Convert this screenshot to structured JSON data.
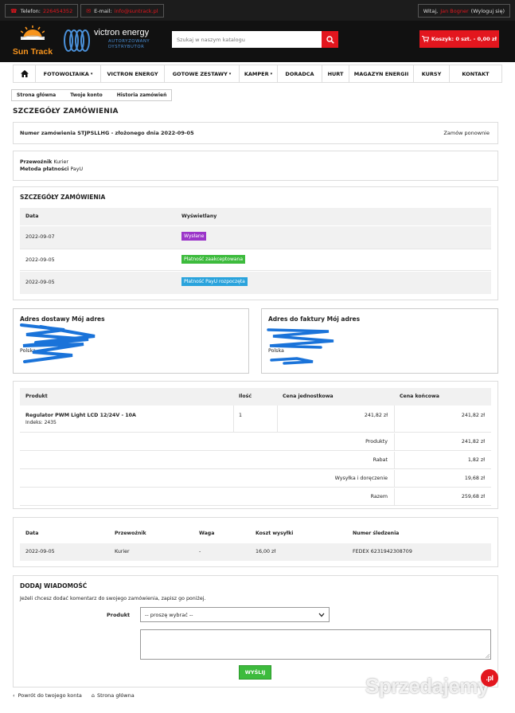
{
  "topbar": {
    "phone_label": "Telefon:",
    "phone_value": "226454352",
    "email_label": "E-mail:",
    "email_value": "info@suntrack.pl",
    "welcome": "Witaj,",
    "user_name": "Jan Bogner",
    "logout": "(Wyloguj się)"
  },
  "header": {
    "logo_name": "Sun Track",
    "victron_name": "victron energy",
    "victron_sub_1": "AUTORYZOWANY",
    "victron_sub_2": "DYSTRYBUTOR",
    "search_placeholder": "Szukaj w naszym katalogu",
    "cart_label": "Koszyk: 0 szt. - 0,00 zł"
  },
  "nav": {
    "items": [
      "FOTOWOLTAIKA",
      "VICTRON ENERGY",
      "GOTOWE ZESTAWY",
      "KAMPER",
      "DORADCA",
      "HURT",
      "MAGAZYN ENERGII",
      "KURSY",
      "KONTAKT"
    ]
  },
  "breadcrumb": [
    "Strona główna",
    "Twoje konto",
    "Historia zamówień"
  ],
  "page_title": "SZCZEGÓŁY ZAMÓWIENIA",
  "order": {
    "number_text": "Numer zamówienia STJPSLLHG - złożonego dnia 2022-09-05",
    "reorder": "Zamów ponownie"
  },
  "carrier": {
    "carrier_label": "Przewoźnik",
    "carrier_value": "Kurier",
    "payment_label": "Metoda płatności",
    "payment_value": "PayU"
  },
  "status": {
    "title": "SZCZEGÓŁY ZAMÓWIENIA",
    "col_date": "Data",
    "col_status": "Wyświetlany",
    "rows": [
      {
        "date": "2022-09-07",
        "status": "Wysłane",
        "color": "#9b35c9"
      },
      {
        "date": "2022-09-05",
        "status": "Płatność zaakceptowana",
        "color": "#3dbb3d"
      },
      {
        "date": "2022-09-05",
        "status": "Płatność PayU rozpoczęta",
        "color": "#2aa3dc"
      }
    ]
  },
  "addresses": {
    "delivery_title": "Adres dostawy Mój adres",
    "delivery_country": "Polska",
    "invoice_title": "Adres do faktury Mój adres",
    "invoice_country": "Polska"
  },
  "products": {
    "col_product": "Produkt",
    "col_qty": "Ilość",
    "col_unit": "Cena jednostkowa",
    "col_total": "Cena końcowa",
    "item_name": "Regulator PWM Light LCD 12/24V - 10A",
    "item_index": "Indeks: 2435",
    "item_qty": "1",
    "item_unit": "241,82 zł",
    "item_total": "241,82 zł",
    "summary": [
      {
        "label": "Produkty",
        "value": "241,82 zł"
      },
      {
        "label": "Rabat",
        "value": "1,82 zł"
      },
      {
        "label": "Wysyłka i doręczenie",
        "value": "19,68 zł"
      },
      {
        "label": "Razem",
        "value": "259,68 zł"
      }
    ]
  },
  "shipping": {
    "col_date": "Data",
    "col_carrier": "Przewoźnik",
    "col_weight": "Waga",
    "col_cost": "Koszt wysyłki",
    "col_tracking": "Numer śledzenia",
    "date": "2022-09-05",
    "carrier": "Kurier",
    "weight": "-",
    "cost": "16,00 zł",
    "tracking": "FEDEX 6231942308709"
  },
  "message": {
    "title": "DODAJ WIADOMOŚĆ",
    "hint": "Jeżeli chcesz dodać komentarz do swojego zamówienia, zapisz go poniżej.",
    "product_label": "Produkt",
    "select_value": "-- proszę wybrać --",
    "send": "WYŚLIJ"
  },
  "footer": {
    "back": "Powrót do twojego konta",
    "home": "Strona główna"
  },
  "watermark": {
    "text": "Sprzedajemy",
    "tld": ".pl"
  }
}
